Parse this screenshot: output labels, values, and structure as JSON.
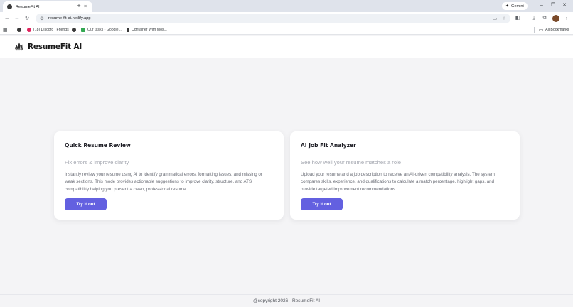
{
  "browser": {
    "tab_title": "ResumeFit AI",
    "tab_close": "×",
    "new_tab": "+",
    "gemini_label": "Gemini",
    "url": "resume-fit-ai.netlify.app",
    "bookmarks": [
      {
        "label": "(18) Discord | Friends",
        "icon": "discord-icon",
        "color": "#e0245e"
      },
      {
        "label": "Our tasks - Google...",
        "icon": "google-tasks-icon",
        "color": "#34a853"
      },
      {
        "label": "Container With Mos...",
        "icon": "leetcode-icon",
        "color": "#3a3a3a"
      }
    ],
    "all_bookmarks": "All Bookmarks"
  },
  "app": {
    "name": "ResumeFit AI"
  },
  "cards": [
    {
      "title": "Quick Resume Review",
      "subtitle": "Fix errors & improve clarity",
      "description": "Instantly review your resume using AI to identify grammatical errors, formatting issues, and missing or weak sections. This mode provides actionable suggestions to improve clarity, structure, and ATS compatibility helping you present a clean, professional resume.",
      "button": "Try it out"
    },
    {
      "title": "AI Job Fit Analyzer",
      "subtitle": "See how well your resume matches a role",
      "description": "Upload your resume and a job description to receive an AI-driven compatibility analysis. The system compares skills, experience, and qualifications to calculate a match percentage, highlight gaps, and provide targeted improvement recommendations.",
      "button": "Try it out"
    }
  ],
  "footer": {
    "text": "@copyright 2026 - ResumeFit AI"
  },
  "colors": {
    "accent": "#6360e0",
    "page_background": "#f4f4f6"
  }
}
